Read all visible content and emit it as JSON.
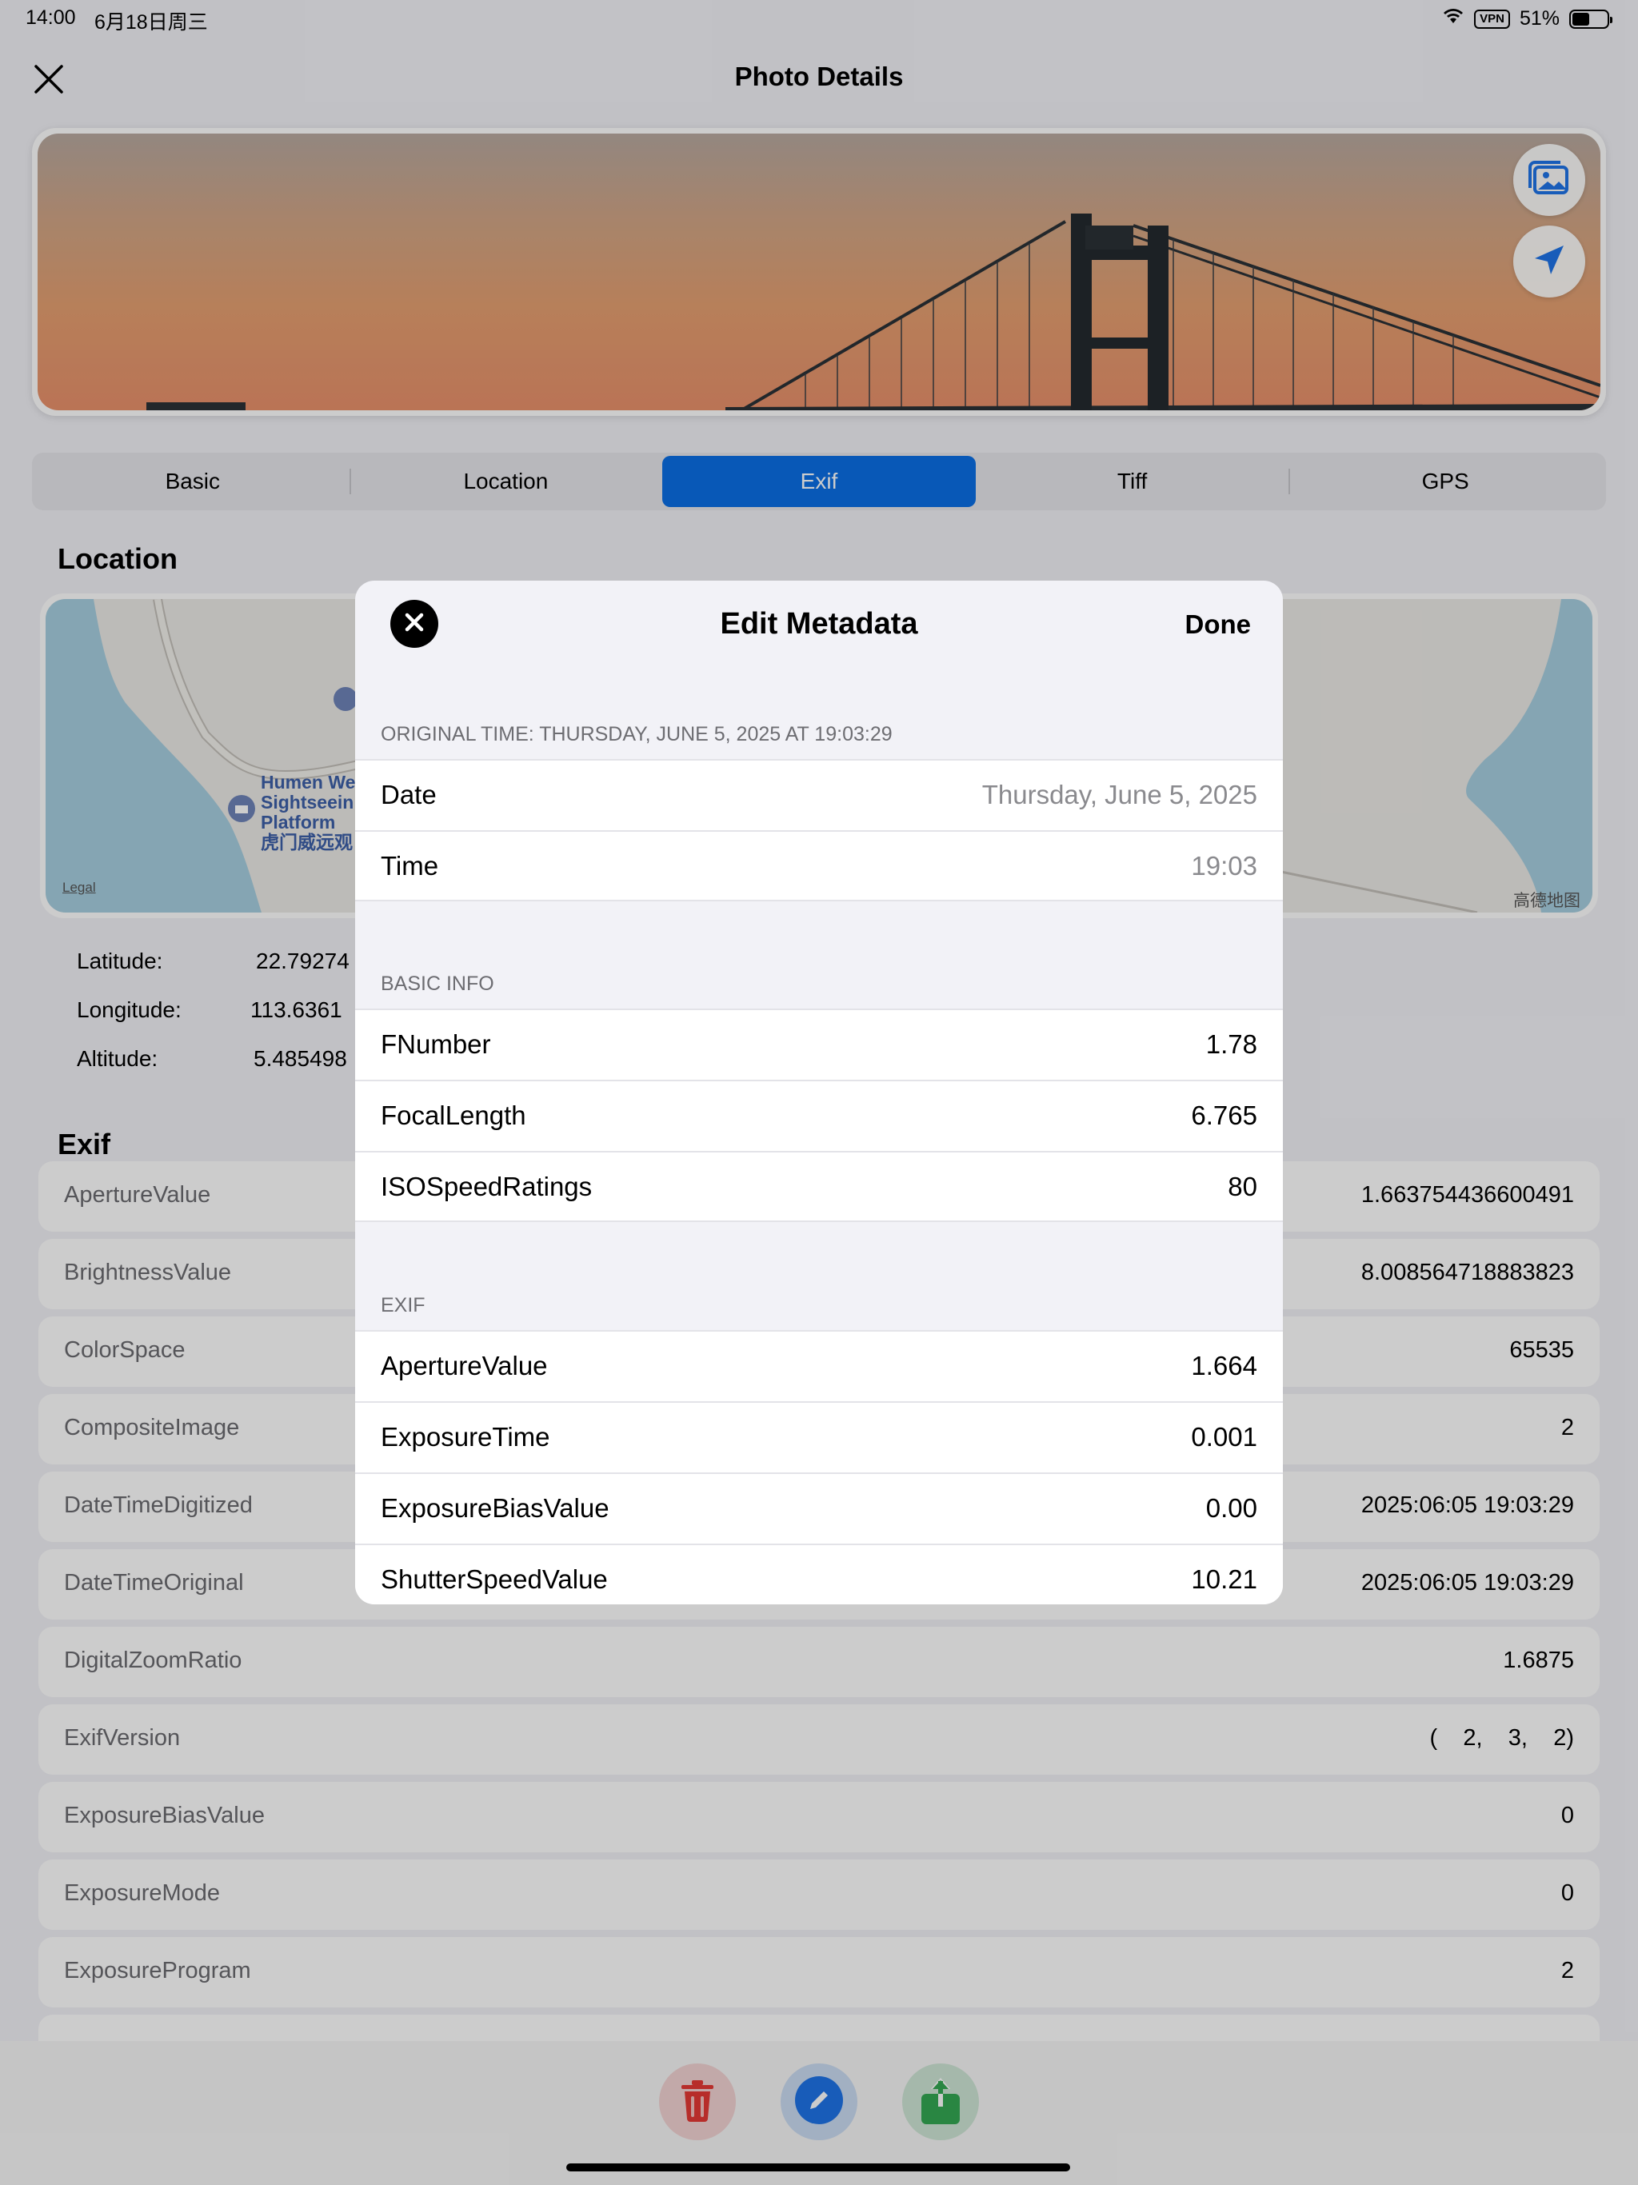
{
  "status_bar": {
    "time": "14:00",
    "date": "6月18日周三",
    "vpn": "VPN",
    "battery": "51%",
    "battery_level": 0.51
  },
  "header": {
    "title": "Photo Details"
  },
  "tabs": [
    {
      "label": "Basic"
    },
    {
      "label": "Location"
    },
    {
      "label": "Exif",
      "active": true
    },
    {
      "label": "Tiff"
    },
    {
      "label": "GPS"
    }
  ],
  "location": {
    "title": "Location",
    "map": {
      "poi_lines": [
        "Humen We",
        "Sightseein",
        "Platform",
        "虎门威远观"
      ],
      "legal": "Legal",
      "provider": "高德地图"
    },
    "coords": [
      {
        "label": "Latitude:",
        "value": "22.79274"
      },
      {
        "label": "Longitude:",
        "value": "113.6361"
      },
      {
        "label": "Altitude:",
        "value": "5.485498"
      }
    ]
  },
  "exif": {
    "title": "Exif",
    "rows": [
      {
        "key": "ApertureValue",
        "value": "1.663754436600491"
      },
      {
        "key": "BrightnessValue",
        "value": "8.008564718883823"
      },
      {
        "key": "ColorSpace",
        "value": "65535"
      },
      {
        "key": "CompositeImage",
        "value": "2"
      },
      {
        "key": "DateTimeDigitized",
        "value": "2025:06:05 19:03:29"
      },
      {
        "key": "DateTimeOriginal",
        "value": "2025:06:05 19:03:29"
      },
      {
        "key": "DigitalZoomRatio",
        "value": "1.6875"
      },
      {
        "key": "ExifVersion",
        "value": "(    2,    3,    2)"
      },
      {
        "key": "ExposureBiasValue",
        "value": "0"
      },
      {
        "key": "ExposureMode",
        "value": "0"
      },
      {
        "key": "ExposureProgram",
        "value": "2"
      }
    ]
  },
  "modal": {
    "title": "Edit Metadata",
    "done_label": "Done",
    "time_header": "ORIGINAL TIME: THURSDAY, JUNE 5, 2025 AT 19:03:29",
    "date_row": {
      "key": "Date",
      "value": "Thursday, June 5, 2025"
    },
    "time_row": {
      "key": "Time",
      "value": "19:03"
    },
    "basic_header": "BASIC INFO",
    "basic_rows": [
      {
        "key": "FNumber",
        "value": "1.78"
      },
      {
        "key": "FocalLength",
        "value": "6.765"
      },
      {
        "key": "ISOSpeedRatings",
        "value": "80"
      }
    ],
    "exif_header": "EXIF",
    "exif_rows": [
      {
        "key": "ApertureValue",
        "value": "1.664"
      },
      {
        "key": "ExposureTime",
        "value": "0.001"
      },
      {
        "key": "ExposureBiasValue",
        "value": "0.00"
      },
      {
        "key": "ShutterSpeedValue",
        "value": "10.21"
      }
    ]
  },
  "actions": {
    "delete_color": "#e53935",
    "edit_color": "#1e73e8",
    "share_color": "#34a853",
    "accent": "#0a6fe5"
  }
}
